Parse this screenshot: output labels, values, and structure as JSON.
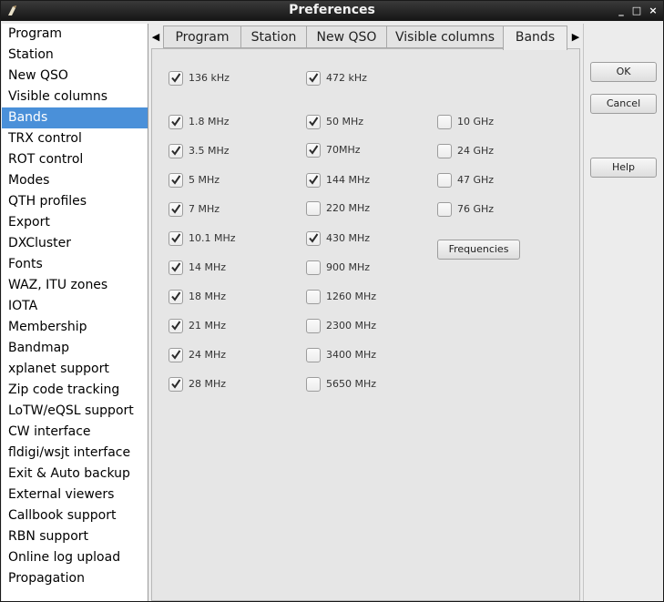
{
  "window": {
    "title": "Preferences",
    "controls": [
      "_",
      "□",
      "×"
    ]
  },
  "sidebar": {
    "selected": "Bands",
    "items": [
      "Program",
      "Station",
      "New QSO",
      "Visible columns",
      "Bands",
      "TRX control",
      "ROT control",
      "Modes",
      "QTH profiles",
      "Export",
      "DXCluster",
      "Fonts",
      "WAZ, ITU zones",
      "IOTA",
      "Membership",
      "Bandmap",
      "xplanet support",
      "Zip code tracking",
      "LoTW/eQSL support",
      "CW interface",
      "fldigi/wsjt interface",
      "Exit & Auto backup",
      "External viewers",
      "Callbook support",
      "RBN support",
      "Online log upload",
      "Propagation"
    ]
  },
  "tabs": {
    "items": [
      "Program",
      "Station",
      "New QSO",
      "Visible columns",
      "Bands"
    ],
    "active": "Bands",
    "scroll_left": "◀",
    "scroll_right": "▶"
  },
  "bands": {
    "col1": [
      {
        "label": "136 kHz",
        "checked": true
      },
      {
        "label": "1.8 MHz",
        "checked": true
      },
      {
        "label": "3.5 MHz",
        "checked": true
      },
      {
        "label": "5 MHz",
        "checked": true
      },
      {
        "label": "7 MHz",
        "checked": true
      },
      {
        "label": "10.1 MHz",
        "checked": true
      },
      {
        "label": "14 MHz",
        "checked": true
      },
      {
        "label": "18 MHz",
        "checked": true
      },
      {
        "label": "21 MHz",
        "checked": true
      },
      {
        "label": "24 MHz",
        "checked": true
      },
      {
        "label": "28 MHz",
        "checked": true
      }
    ],
    "col2": [
      {
        "label": "472 kHz",
        "checked": true
      },
      {
        "label": "50 MHz",
        "checked": true
      },
      {
        "label": "70MHz",
        "checked": true
      },
      {
        "label": "144 MHz",
        "checked": true
      },
      {
        "label": "220 MHz",
        "checked": false
      },
      {
        "label": "430 MHz",
        "checked": true
      },
      {
        "label": "900 MHz",
        "checked": false
      },
      {
        "label": "1260 MHz",
        "checked": false
      },
      {
        "label": "2300 MHz",
        "checked": false
      },
      {
        "label": "3400 MHz",
        "checked": false
      },
      {
        "label": "5650 MHz",
        "checked": false
      }
    ],
    "col3": [
      {
        "label": "10 GHz",
        "checked": false
      },
      {
        "label": "24 GHz",
        "checked": false
      },
      {
        "label": "47 GHz",
        "checked": false
      },
      {
        "label": "76 GHz",
        "checked": false
      }
    ],
    "frequencies_button": "Frequencies"
  },
  "buttons": {
    "ok": "OK",
    "cancel": "Cancel",
    "help": "Help"
  }
}
